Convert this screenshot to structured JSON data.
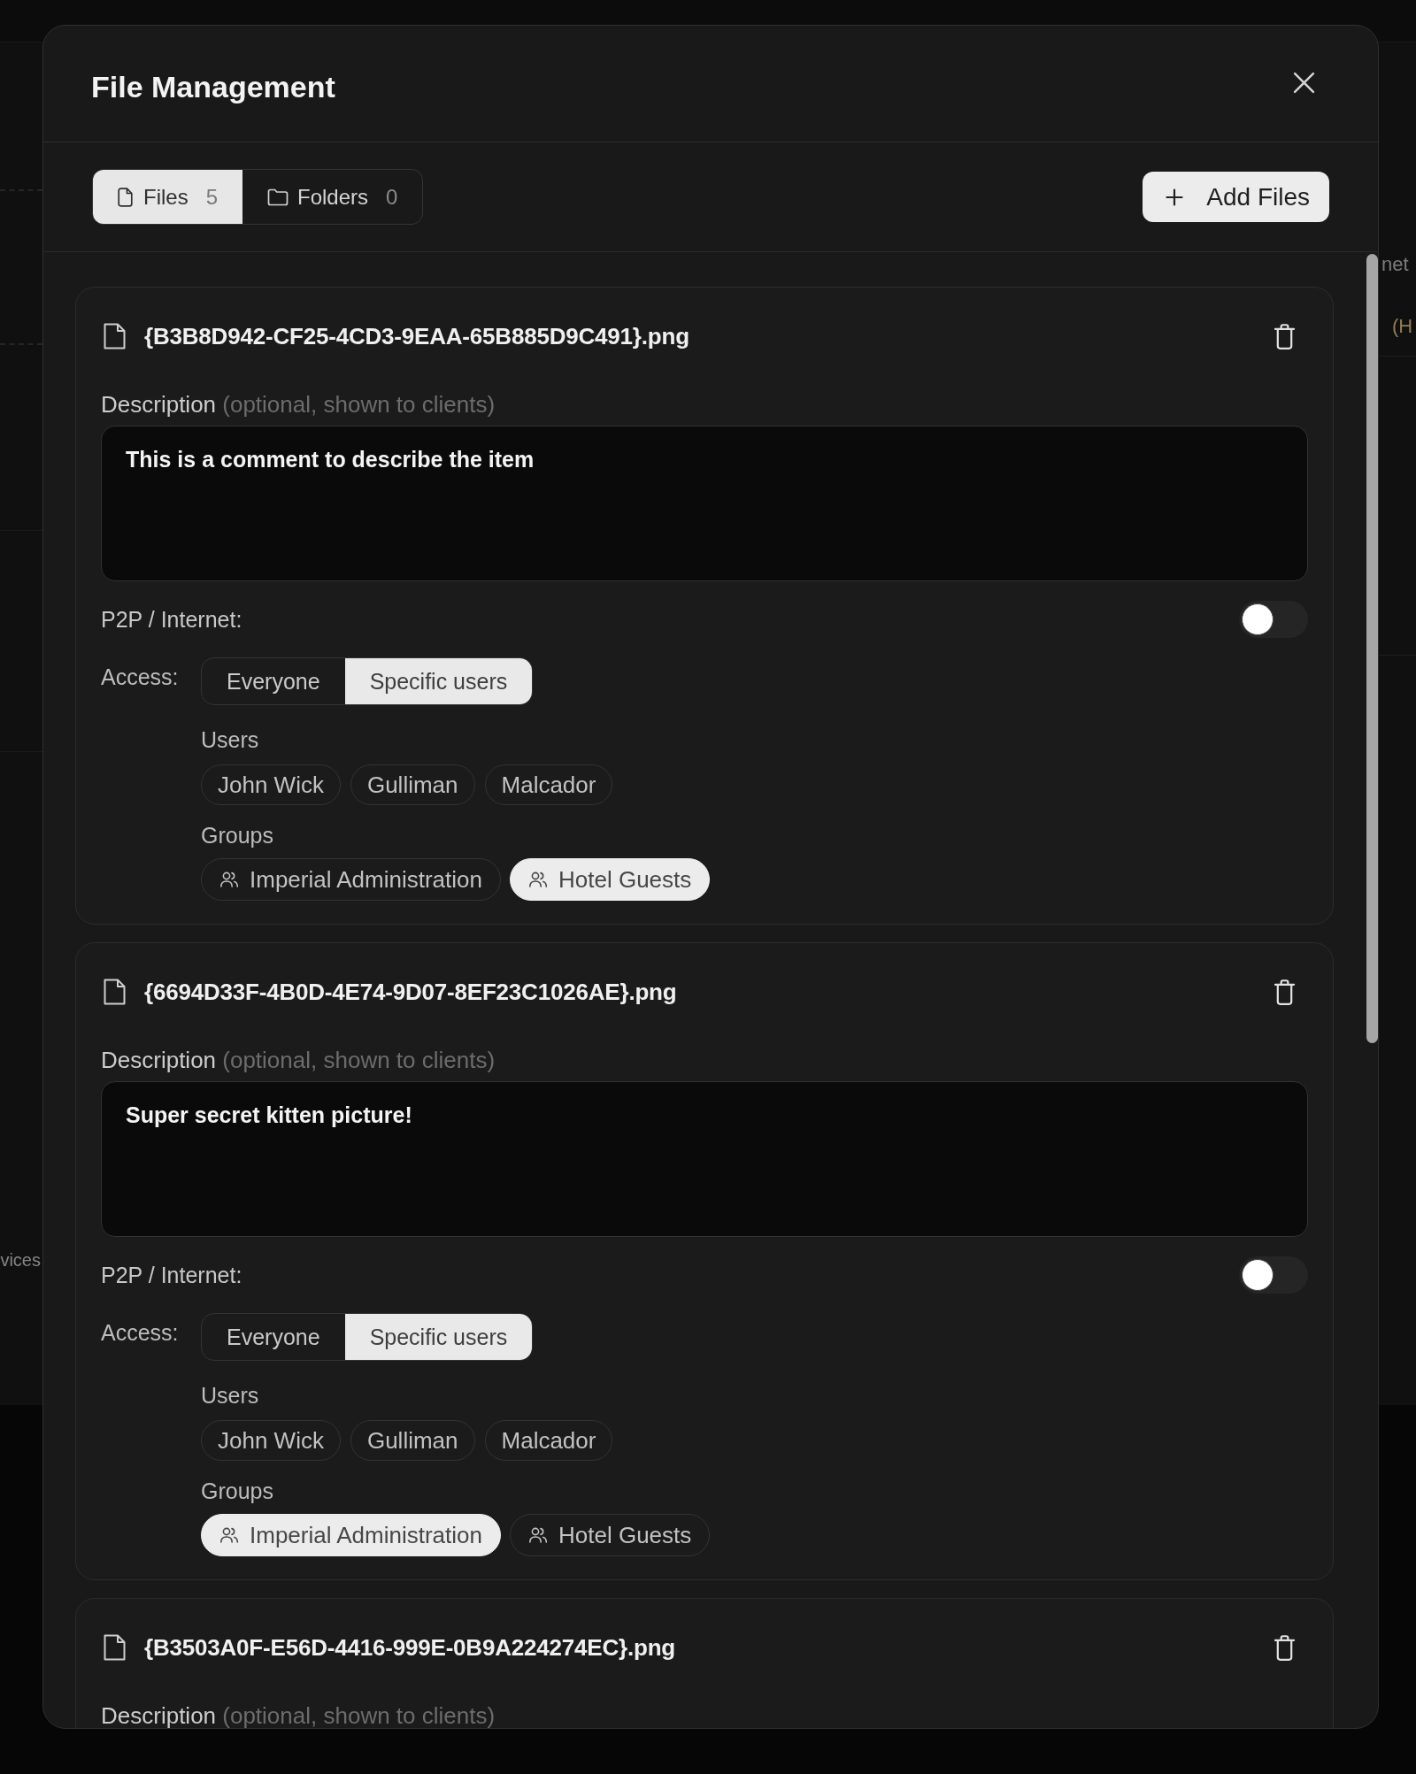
{
  "dialog": {
    "title": "File Management"
  },
  "tabs": [
    {
      "kind": "file",
      "label": "Files",
      "count": "5",
      "selected": true
    },
    {
      "kind": "folder",
      "label": "Folders",
      "count": "0",
      "selected": false
    }
  ],
  "add_button": {
    "label": "Add Files"
  },
  "files": [
    {
      "name": "{B3B8D942-CF25-4CD3-9EAA-65B885D9C491}.png",
      "description": {
        "label": "Description",
        "hint": "(optional, shown to clients)",
        "value": "This is a comment to describe the item"
      },
      "p2p": {
        "label": "P2P / Internet:",
        "on": false
      },
      "access": {
        "label": "Access:",
        "options": [
          {
            "label": "Everyone",
            "selected": false
          },
          {
            "label": "Specific users",
            "selected": true
          }
        ]
      },
      "users": {
        "label": "Users",
        "items": [
          {
            "name": "John Wick",
            "selected": false
          },
          {
            "name": "Gulliman",
            "selected": false
          },
          {
            "name": "Malcador",
            "selected": false
          }
        ]
      },
      "groups": {
        "label": "Groups",
        "items": [
          {
            "name": "Imperial Administration",
            "selected": false
          },
          {
            "name": "Hotel Guests",
            "selected": true
          }
        ]
      }
    },
    {
      "name": "{6694D33F-4B0D-4E74-9D07-8EF23C1026AE}.png",
      "description": {
        "label": "Description",
        "hint": "(optional, shown to clients)",
        "value": "Super secret kitten picture!"
      },
      "p2p": {
        "label": "P2P / Internet:",
        "on": false
      },
      "access": {
        "label": "Access:",
        "options": [
          {
            "label": "Everyone",
            "selected": false
          },
          {
            "label": "Specific users",
            "selected": true
          }
        ]
      },
      "users": {
        "label": "Users",
        "items": [
          {
            "name": "John Wick",
            "selected": false
          },
          {
            "name": "Gulliman",
            "selected": false
          },
          {
            "name": "Malcador",
            "selected": false
          }
        ]
      },
      "groups": {
        "label": "Groups",
        "items": [
          {
            "name": "Imperial Administration",
            "selected": true
          },
          {
            "name": "Hotel Guests",
            "selected": false
          }
        ]
      }
    },
    {
      "name": "{B3503A0F-E56D-4416-999E-0B9A224274EC}.png",
      "description": {
        "label": "Description",
        "hint": "(optional, shown to clients)"
      }
    }
  ],
  "background_page": {
    "texts_right": [
      {
        "text": "net",
        "color": "#7c7c7c"
      },
      {
        "text": "(H",
        "color": "#8f7d55"
      }
    ],
    "text_left": "vices"
  }
}
